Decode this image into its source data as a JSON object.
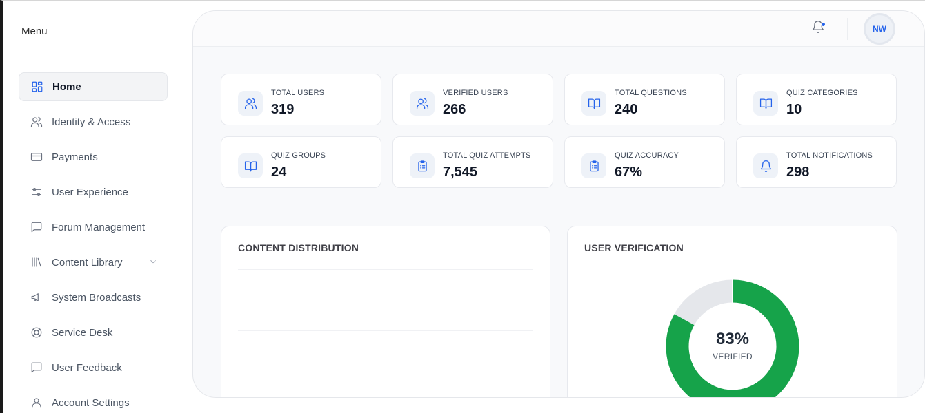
{
  "sidebar": {
    "title": "Menu",
    "items": [
      {
        "label": "Home",
        "icon": "dashboard-icon",
        "active": true
      },
      {
        "label": "Identity & Access",
        "icon": "users-icon"
      },
      {
        "label": "Payments",
        "icon": "credit-card-icon"
      },
      {
        "label": "User Experience",
        "icon": "sliders-icon"
      },
      {
        "label": "Forum Management",
        "icon": "message-square-icon"
      },
      {
        "label": "Content Library",
        "icon": "library-icon",
        "expandable": true
      },
      {
        "label": "System Broadcasts",
        "icon": "megaphone-icon"
      },
      {
        "label": "Service Desk",
        "icon": "lifebuoy-icon"
      },
      {
        "label": "User Feedback",
        "icon": "message-square-icon"
      },
      {
        "label": "Account Settings",
        "icon": "user-icon"
      }
    ]
  },
  "header": {
    "notification_icon": "bell-icon",
    "avatar_initials": "NW"
  },
  "stats": [
    {
      "label": "TOTAL USERS",
      "value": "319",
      "icon": "users-icon"
    },
    {
      "label": "VERIFIED USERS",
      "value": "266",
      "icon": "users-icon"
    },
    {
      "label": "TOTAL QUESTIONS",
      "value": "240",
      "icon": "book-open-icon"
    },
    {
      "label": "QUIZ CATEGORIES",
      "value": "10",
      "icon": "book-open-icon"
    },
    {
      "label": "QUIZ GROUPS",
      "value": "24",
      "icon": "book-open-icon"
    },
    {
      "label": "TOTAL QUIZ ATTEMPTS",
      "value": "7,545",
      "icon": "clipboard-list-icon"
    },
    {
      "label": "QUIZ ACCURACY",
      "value": "67%",
      "icon": "clipboard-list-icon"
    },
    {
      "label": "TOTAL NOTIFICATIONS",
      "value": "298",
      "icon": "bell-icon"
    }
  ],
  "content_distribution": {
    "title": "CONTENT DISTRIBUTION"
  },
  "user_verification": {
    "title": "USER VERIFICATION",
    "percent_label": "83%",
    "sub_label": "VERIFIED",
    "verified_fraction": 0.83,
    "colors": {
      "verified": "#16a34a",
      "unverified": "#e5e7eb"
    }
  },
  "colors": {
    "accent": "#2563eb",
    "verified": "#16a34a"
  }
}
